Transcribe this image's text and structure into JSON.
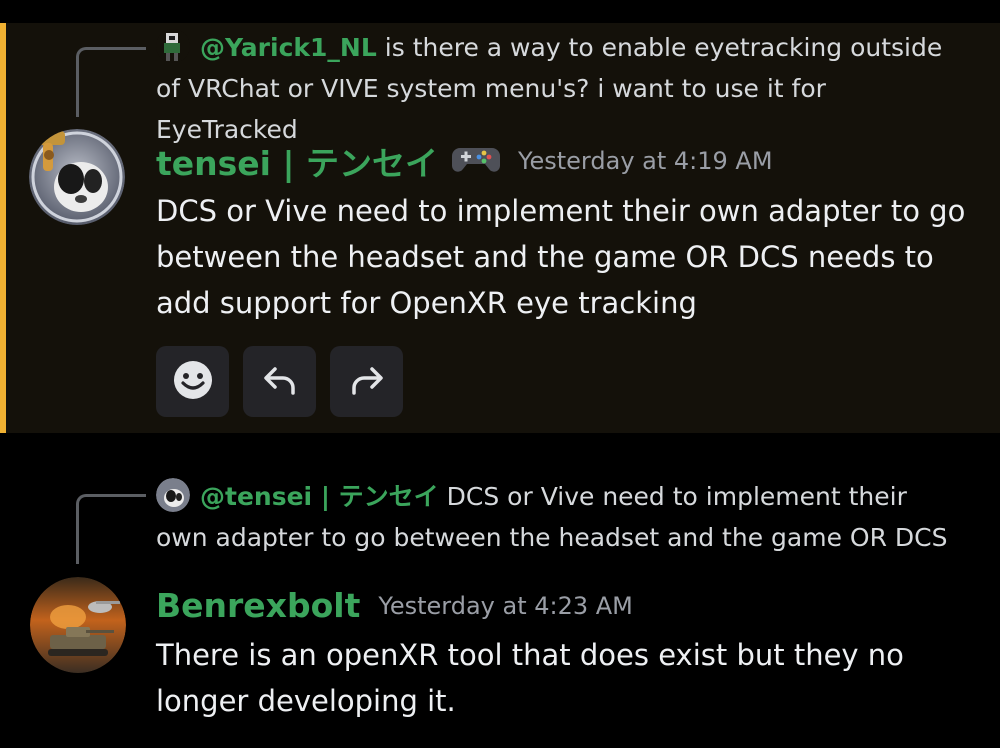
{
  "messages": [
    {
      "reply_to": {
        "mention": "@Yarick1_NL",
        "text": "is there a way to enable eyetracking outside of VRChat or VIVE system menu's?  i want to use it for EyeTracked"
      },
      "author": "tensei | テンセイ",
      "timestamp": "Yesterday at 4:19 AM",
      "content": "DCS or Vive need to implement their own adapter to go between the headset and the game OR DCS needs to add support for OpenXR eye tracking",
      "highlighted": true,
      "actions": [
        {
          "icon": "emoji-icon"
        },
        {
          "icon": "reply-icon"
        },
        {
          "icon": "forward-icon"
        }
      ]
    },
    {
      "reply_to": {
        "mention": "@tensei | テンセイ",
        "text": "DCS or Vive need to implement their own adapter to go between the headset and the game OR DCS"
      },
      "author": "Benrexbolt",
      "timestamp": "Yesterday at 4:23 AM",
      "content": "There is an openXR tool that does exist but they no longer developing it.",
      "highlighted": false
    }
  ],
  "colors": {
    "username": "#3ba55c",
    "highlight_bar": "#f0b132",
    "highlight_bg": "#14110a",
    "timestamp": "#9a9ea6"
  }
}
